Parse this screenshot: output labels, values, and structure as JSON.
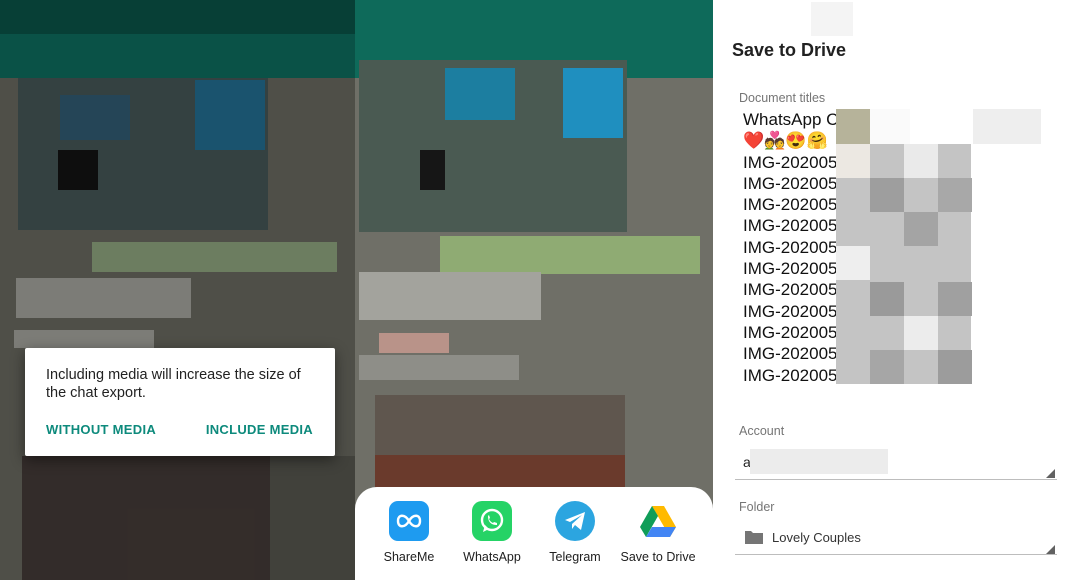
{
  "dialog": {
    "message": "Including media will increase the size of the chat export.",
    "without_media": "WITHOUT MEDIA",
    "include_media": "INCLUDE MEDIA"
  },
  "share_sheet": {
    "apps": [
      {
        "label": "ShareMe",
        "icon": "shareme-icon",
        "color": "#1e9bf0"
      },
      {
        "label": "WhatsApp",
        "icon": "whatsapp-icon",
        "color": "#25d366"
      },
      {
        "label": "Telegram",
        "icon": "telegram-icon",
        "color": "#2ca5e0"
      },
      {
        "label": "Save to Drive",
        "icon": "google-drive-icon",
        "color": "#ffffff"
      }
    ]
  },
  "drive": {
    "title": "Save to Drive",
    "doc_titles_label": "Document titles",
    "documents": [
      "WhatsApp C",
      "❤️💑😍🤗",
      "IMG-202005",
      "IMG-202005",
      "IMG-202005",
      "IMG-202005",
      "IMG-202005",
      "IMG-202005",
      "IMG-202005",
      "IMG-202005",
      "IMG-202005",
      "IMG-202005",
      "IMG-202005"
    ],
    "account_label": "Account",
    "account_value": "a",
    "folder_label": "Folder",
    "folder_value": "Lovely Couples"
  },
  "colors": {
    "accent": "#0d8a7c",
    "whatsapp_header": "#0a5247",
    "whatsapp_status": "#073f36"
  }
}
